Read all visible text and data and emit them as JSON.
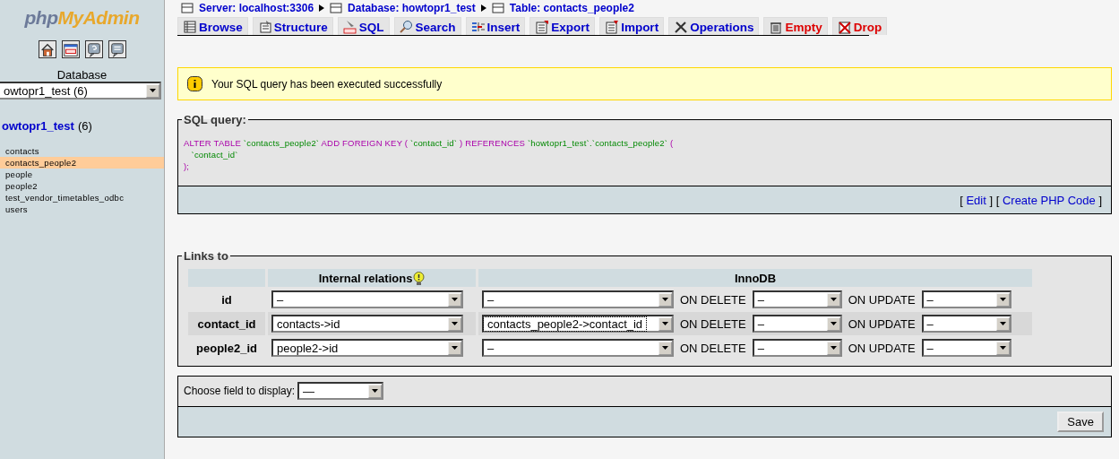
{
  "sidebar": {
    "logo": {
      "first": "php",
      "second": "MyAdmin"
    },
    "database_label": "Database",
    "database_select": {
      "value": "owtopr1_test (6)"
    },
    "database_title": {
      "name": "owtopr1_test",
      "count": "(6)"
    },
    "tables": [
      {
        "name": "contacts",
        "selected": false
      },
      {
        "name": "contacts_people2",
        "selected": true
      },
      {
        "name": "people",
        "selected": false
      },
      {
        "name": "people2",
        "selected": false
      },
      {
        "name": "test_vendor_timetables_odbc",
        "selected": false
      },
      {
        "name": "users",
        "selected": false
      }
    ]
  },
  "breadcrumb": [
    "Server: localhost:3306",
    "Database: howtopr1_test",
    "Table: contacts_people2"
  ],
  "tabs": [
    {
      "label": "Browse",
      "kind": "normal"
    },
    {
      "label": "Structure",
      "kind": "normal"
    },
    {
      "label": "SQL",
      "kind": "normal"
    },
    {
      "label": "Search",
      "kind": "normal"
    },
    {
      "label": "Insert",
      "kind": "normal"
    },
    {
      "label": "Export",
      "kind": "normal"
    },
    {
      "label": "Import",
      "kind": "normal"
    },
    {
      "label": "Operations",
      "kind": "normal"
    },
    {
      "label": "Empty",
      "kind": "danger"
    },
    {
      "label": "Drop",
      "kind": "danger"
    }
  ],
  "message": "Your SQL query has been executed successfully",
  "sql_query": {
    "legend": "SQL query:",
    "lines": [
      [
        {
          "kind": "keyword",
          "text": "ALTER TABLE"
        },
        {
          "kind": "identifier",
          "text": "`contacts_people2`"
        },
        {
          "kind": "keyword",
          "text": "ADD FOREIGN KEY ("
        },
        {
          "kind": "identifier",
          "text": "`contact_id`"
        },
        {
          "kind": "keyword",
          "text": ") REFERENCES"
        },
        {
          "kind": "identifier",
          "text": "`howtopr1_test`.`contacts_people2`"
        },
        {
          "kind": "keyword",
          "text": "("
        }
      ],
      [
        {
          "kind": "identifier",
          "text": "`contact_id`"
        }
      ],
      [
        {
          "kind": "keyword",
          "text": ");"
        }
      ]
    ],
    "links": [
      {
        "open": "[",
        "label": "Edit",
        "close": "]"
      },
      {
        "open": "[",
        "label": "Create PHP Code",
        "close": "]"
      }
    ]
  },
  "links_to": {
    "legend": "Links to",
    "headers": [
      "Internal relations",
      "InnoDB"
    ],
    "rows": [
      {
        "field": "id",
        "highlighted": false,
        "internal": "–",
        "innodb": "–",
        "innodb_focused": false,
        "on_delete_label": "ON DELETE",
        "on_delete": "–",
        "on_update_label": "ON UPDATE",
        "on_update": "–"
      },
      {
        "field": "contact_id",
        "highlighted": true,
        "internal": "contacts->id",
        "innodb": "contacts_people2->contact_id",
        "innodb_focused": true,
        "on_delete_label": "ON DELETE",
        "on_delete": "–",
        "on_update_label": "ON UPDATE",
        "on_update": "–"
      },
      {
        "field": "people2_id",
        "highlighted": false,
        "internal": "people2->id",
        "innodb": "–",
        "innodb_focused": false,
        "on_delete_label": "ON DELETE",
        "on_delete": "–",
        "on_update_label": "ON UPDATE",
        "on_update": "–"
      }
    ]
  },
  "display_field": {
    "label": "Choose field to display:",
    "value": "—"
  },
  "save_button": "Save"
}
